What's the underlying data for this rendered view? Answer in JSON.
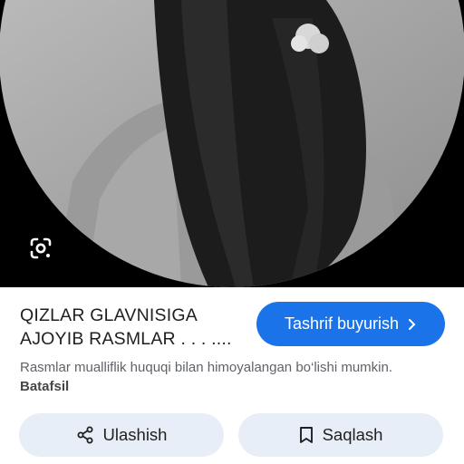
{
  "result": {
    "title": "QIZLAR GLAVNISIGA AJOYIB RASMLAR . . . ....",
    "visit_label": "Tashrif buyurish",
    "copyright_text": "Rasmlar mualliflik huquqi bilan himoyalangan bo‘lishi mumkin.",
    "more_label": "Batafsil"
  },
  "actions": {
    "share_label": "Ulashish",
    "save_label": "Saqlash"
  },
  "icons": {
    "lens": "google-lens-icon",
    "visit_chevron": "chevron-right-icon",
    "share": "share-icon",
    "save": "bookmark-icon"
  },
  "colors": {
    "accent": "#1a73e8",
    "pill_bg": "#e8eef8"
  }
}
